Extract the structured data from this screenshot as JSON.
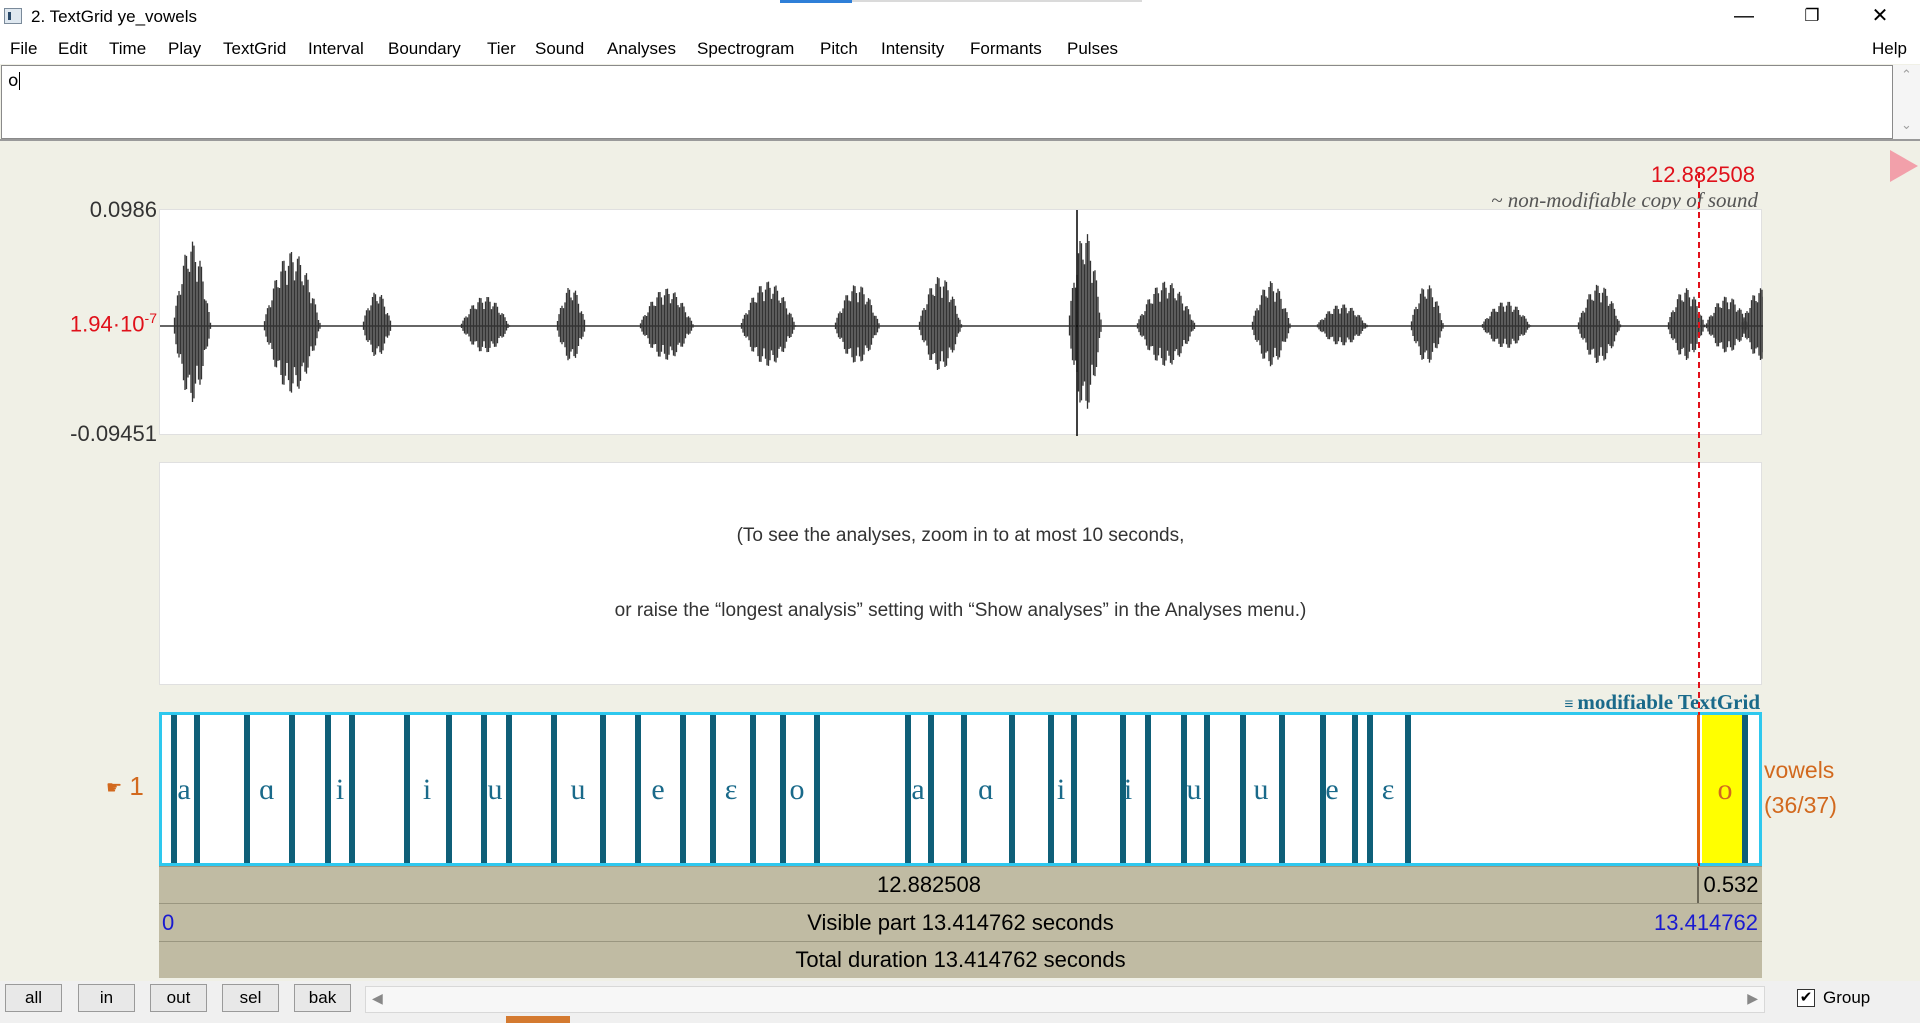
{
  "window": {
    "title": "2. TextGrid ye_vowels",
    "controls": [
      "minimize-icon",
      "restore-icon",
      "close-icon"
    ]
  },
  "menu": {
    "items": [
      "File",
      "Edit",
      "Time",
      "Play",
      "TextGrid",
      "Interval",
      "Boundary",
      "Tier",
      "Sound",
      "Analyses",
      "Spectrogram",
      "Pitch",
      "Intensity",
      "Formants",
      "Pulses"
    ],
    "help": "Help"
  },
  "text_field": {
    "value": "o"
  },
  "cursor_time": "12.882508",
  "sound": {
    "label": "~ non-modifiable copy of sound",
    "y_max": "0.0986",
    "y_mid_mantissa": "1.94·10",
    "y_mid_exp": "-7",
    "y_min": "-0.09451"
  },
  "analysis_message": {
    "line1": "(To see the analyses, zoom in to at most 10 seconds,",
    "line2": "or raise the “longest analysis” setting with “Show analyses” in the Analyses menu.)"
  },
  "textgrid": {
    "label": "modifiable TextGrid",
    "tier_number": "1",
    "tier_name": "vowels",
    "tier_count": "(36/37)",
    "intervals": [
      "a",
      "ɑ",
      "i",
      "i",
      "u",
      "u",
      "e",
      "ɛ",
      "o",
      "a",
      "ɑ",
      "i",
      "i",
      "u",
      "u",
      "e",
      "ɛ",
      "o"
    ],
    "selected_label": "o"
  },
  "timebars": {
    "selection_left": "12.882508",
    "selection_right": "0.532",
    "visible_start": "0",
    "visible_part": "Visible part 13.414762 seconds",
    "visible_end": "13.414762",
    "total": "Total duration 13.414762 seconds"
  },
  "bottom": {
    "buttons": [
      "all",
      "in",
      "out",
      "sel",
      "bak"
    ],
    "group_label": "Group",
    "group_checked": true
  },
  "colors": {
    "cursor": "#e0101a",
    "tier_border": "#2ec8ee",
    "boundary": "#0f5f78",
    "selection_fill": "#ffff00",
    "orange_text": "#d2691e"
  }
}
